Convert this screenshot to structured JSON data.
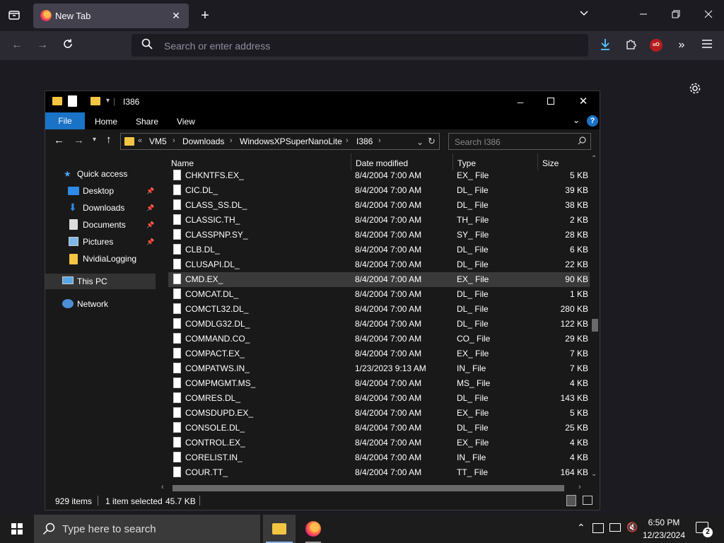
{
  "browser": {
    "tab_title": "New Tab",
    "new_tab_glyph": "+",
    "url_placeholder": "Search or enter address",
    "ubo_label": "uO"
  },
  "explorer": {
    "title": "I386",
    "ribbon": {
      "file": "File",
      "home": "Home",
      "share": "Share",
      "view": "View"
    },
    "breadcrumb": {
      "overflow": "«",
      "items": [
        "VM5",
        "Downloads",
        "WindowsXPSuperNanoLite",
        "I386"
      ]
    },
    "search_placeholder": "Search I386",
    "nav": {
      "quick_access": "Quick access",
      "desktop": "Desktop",
      "downloads": "Downloads",
      "documents": "Documents",
      "pictures": "Pictures",
      "nvidia_logging": "NvidiaLogging",
      "this_pc": "This PC",
      "network": "Network"
    },
    "columns": {
      "name": "Name",
      "date": "Date modified",
      "type": "Type",
      "size": "Size"
    },
    "files": [
      {
        "name": "CHKNTFS.EX_",
        "date": "8/4/2004 7:00 AM",
        "type": "EX_ File",
        "size": "5 KB"
      },
      {
        "name": "CIC.DL_",
        "date": "8/4/2004 7:00 AM",
        "type": "DL_ File",
        "size": "39 KB"
      },
      {
        "name": "CLASS_SS.DL_",
        "date": "8/4/2004 7:00 AM",
        "type": "DL_ File",
        "size": "38 KB"
      },
      {
        "name": "CLASSIC.TH_",
        "date": "8/4/2004 7:00 AM",
        "type": "TH_ File",
        "size": "2 KB"
      },
      {
        "name": "CLASSPNP.SY_",
        "date": "8/4/2004 7:00 AM",
        "type": "SY_ File",
        "size": "28 KB"
      },
      {
        "name": "CLB.DL_",
        "date": "8/4/2004 7:00 AM",
        "type": "DL_ File",
        "size": "6 KB"
      },
      {
        "name": "CLUSAPI.DL_",
        "date": "8/4/2004 7:00 AM",
        "type": "DL_ File",
        "size": "22 KB"
      },
      {
        "name": "CMD.EX_",
        "date": "8/4/2004 7:00 AM",
        "type": "EX_ File",
        "size": "90 KB",
        "selected": true
      },
      {
        "name": "COMCAT.DL_",
        "date": "8/4/2004 7:00 AM",
        "type": "DL_ File",
        "size": "1 KB"
      },
      {
        "name": "COMCTL32.DL_",
        "date": "8/4/2004 7:00 AM",
        "type": "DL_ File",
        "size": "280 KB"
      },
      {
        "name": "COMDLG32.DL_",
        "date": "8/4/2004 7:00 AM",
        "type": "DL_ File",
        "size": "122 KB"
      },
      {
        "name": "COMMAND.CO_",
        "date": "8/4/2004 7:00 AM",
        "type": "CO_ File",
        "size": "29 KB"
      },
      {
        "name": "COMPACT.EX_",
        "date": "8/4/2004 7:00 AM",
        "type": "EX_ File",
        "size": "7 KB"
      },
      {
        "name": "COMPATWS.IN_",
        "date": "1/23/2023 9:13 AM",
        "type": "IN_ File",
        "size": "7 KB"
      },
      {
        "name": "COMPMGMT.MS_",
        "date": "8/4/2004 7:00 AM",
        "type": "MS_ File",
        "size": "4 KB"
      },
      {
        "name": "COMRES.DL_",
        "date": "8/4/2004 7:00 AM",
        "type": "DL_ File",
        "size": "143 KB"
      },
      {
        "name": "COMSDUPD.EX_",
        "date": "8/4/2004 7:00 AM",
        "type": "EX_ File",
        "size": "5 KB"
      },
      {
        "name": "CONSOLE.DL_",
        "date": "8/4/2004 7:00 AM",
        "type": "DL_ File",
        "size": "25 KB"
      },
      {
        "name": "CONTROL.EX_",
        "date": "8/4/2004 7:00 AM",
        "type": "EX_ File",
        "size": "4 KB"
      },
      {
        "name": "CORELIST.IN_",
        "date": "8/4/2004 7:00 AM",
        "type": "IN_ File",
        "size": "4 KB"
      },
      {
        "name": "COUR.TT_",
        "date": "8/4/2004 7:00 AM",
        "type": "TT_ File",
        "size": "164 KB"
      }
    ],
    "status": {
      "items": "929 items",
      "selected": "1 item selected",
      "size": "45.7 KB"
    }
  },
  "taskbar": {
    "search_placeholder": "Type here to search",
    "time": "6:50 PM",
    "date": "12/23/2024",
    "notification_count": "2"
  },
  "colors": {
    "file_tab": "#1a73c7",
    "selected_row": "#3a3a3a",
    "folder": "#f4c542"
  }
}
